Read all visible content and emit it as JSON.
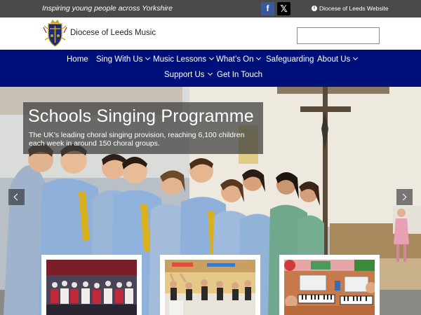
{
  "topbar": {
    "tagline": "Inspiring young people across Yorkshire",
    "facebook_icon": "facebook-icon",
    "x_icon": "x-icon",
    "diocese_link": "Diocese of Leeds Website"
  },
  "header": {
    "site_title": "Diocese of Leeds Music",
    "logo_icon": "diocese-crest-logo",
    "search_placeholder": ""
  },
  "nav": {
    "items": [
      {
        "label": "Home"
      },
      {
        "label": "Sing With Us"
      },
      {
        "label": "Music Lessons"
      },
      {
        "label": "What’s On"
      },
      {
        "label": "Safeguarding"
      },
      {
        "label": "About Us"
      },
      {
        "label": "Support Us"
      },
      {
        "label": "Get In Touch"
      }
    ]
  },
  "hero": {
    "title": "Schools Singing Programme",
    "subtitle": "The UK’s leading choral singing provision, reaching 6,100 children each week in around 150 choral groups."
  },
  "colors": {
    "topbar": "#4a4a4a",
    "nav": "#00107a",
    "facebook": "#3b5998"
  }
}
